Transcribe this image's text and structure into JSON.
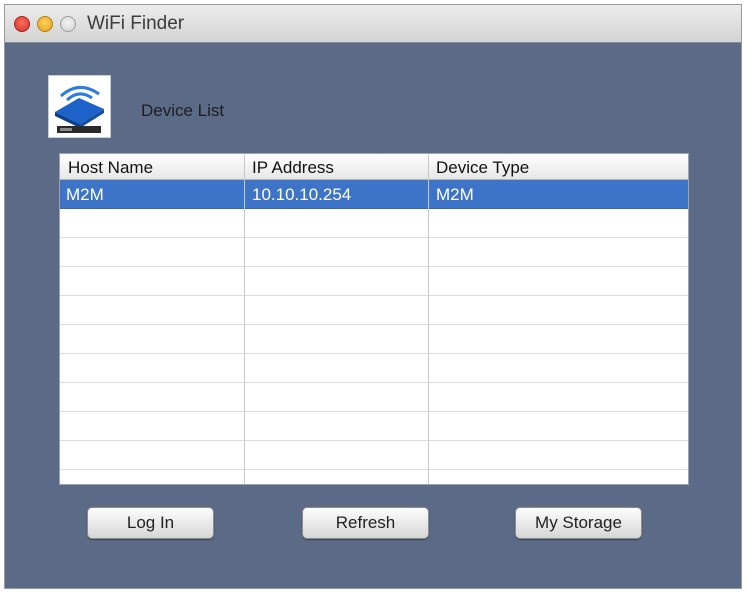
{
  "window": {
    "title": "WiFi Finder"
  },
  "header": {
    "label": "Device List"
  },
  "table": {
    "columns": [
      "Host Name",
      "IP Address",
      "Device Type"
    ],
    "rows": [
      {
        "host": "M2M",
        "ip": "10.10.10.254",
        "type": "M2M",
        "selected": true
      }
    ],
    "selection_color": "#3d74c7"
  },
  "buttons": {
    "login": "Log In",
    "refresh": "Refresh",
    "storage": "My Storage"
  },
  "colors": {
    "window_bg": "#5b6a86"
  }
}
